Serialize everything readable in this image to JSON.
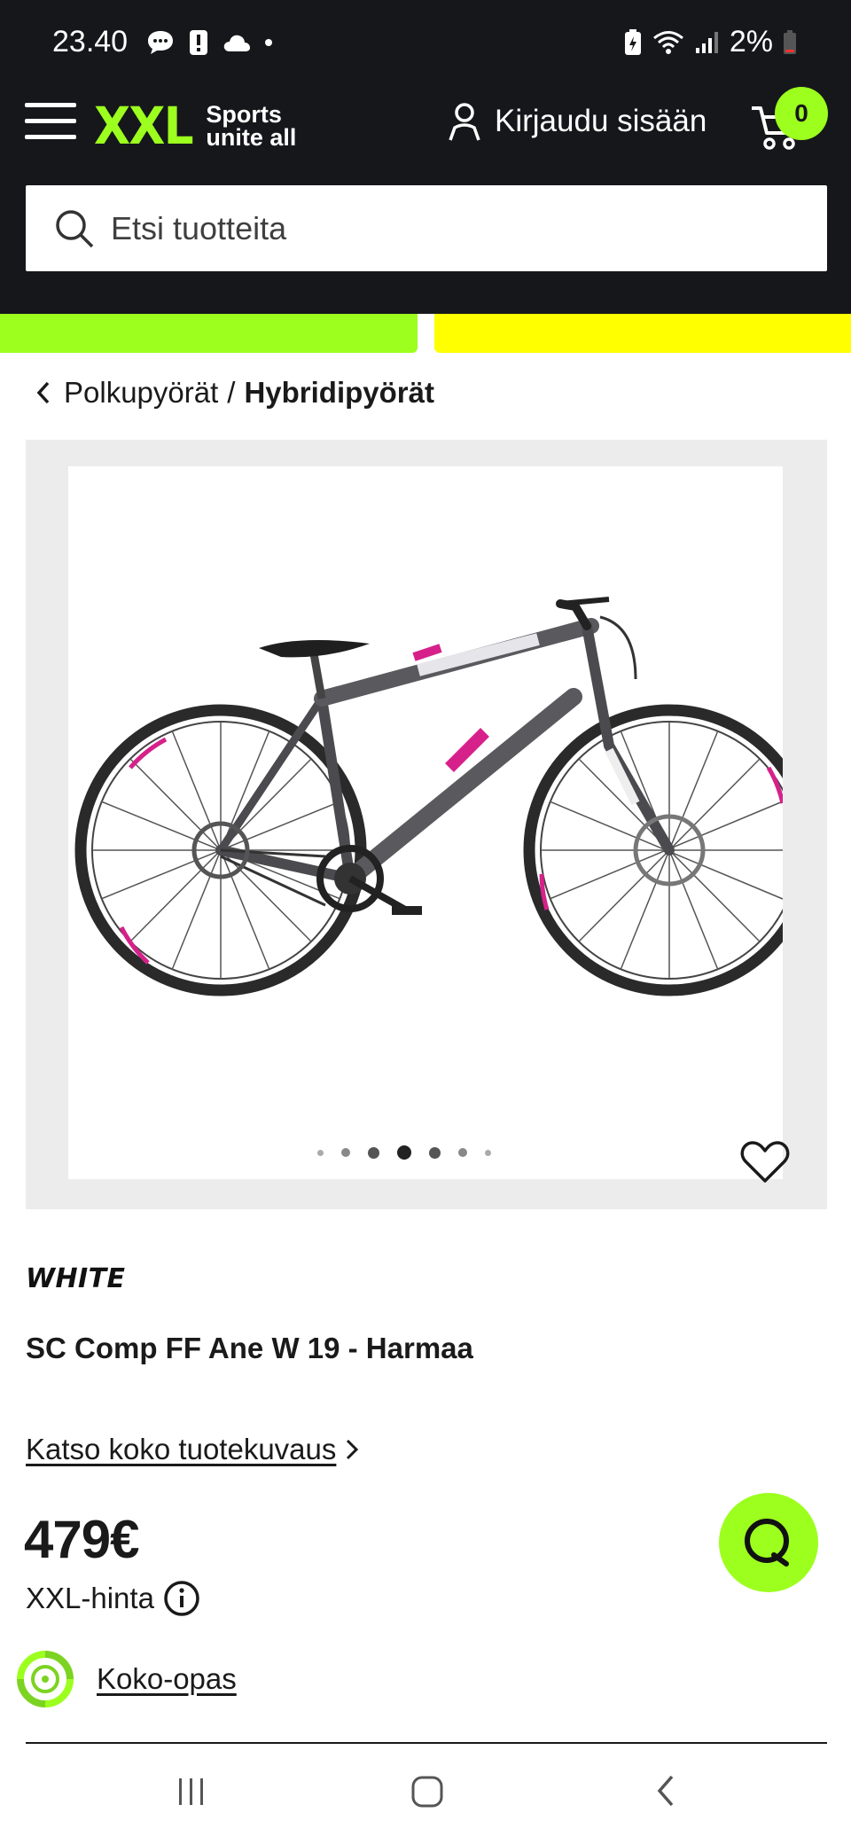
{
  "status_bar": {
    "time": "23.40",
    "battery": "2%",
    "icons_left": [
      "chat-bubble-icon",
      "notification-icon",
      "cloud-icon",
      "dot-icon"
    ],
    "icons_right": [
      "battery-saver-icon",
      "wifi-icon",
      "signal-icon",
      "battery-icon"
    ]
  },
  "header": {
    "logo_text": "XXL",
    "logo_tagline_1": "Sports",
    "logo_tagline_2": "unite all",
    "login_label": "Kirjaudu sisään",
    "cart_count": "0",
    "search_placeholder": "Etsi tuotteita",
    "accent_color": "#9cff1e"
  },
  "breadcrumb": {
    "parent": "Polkupyörät",
    "separator": "/",
    "current": "Hybridipyörät"
  },
  "gallery": {
    "image_alt": "bike-image",
    "total_images": 7,
    "active_index": 3
  },
  "product": {
    "brand": "WHITE",
    "title": "SC Comp FF Ane W 19 - Harmaa",
    "description_link": "Katso koko tuotekuvaus",
    "price": "479€",
    "price_label": "XXL-hinta",
    "size_guide": "Koko-opas"
  },
  "nav_bar": {
    "buttons": [
      "recent-apps-icon",
      "home-icon",
      "back-icon"
    ]
  }
}
